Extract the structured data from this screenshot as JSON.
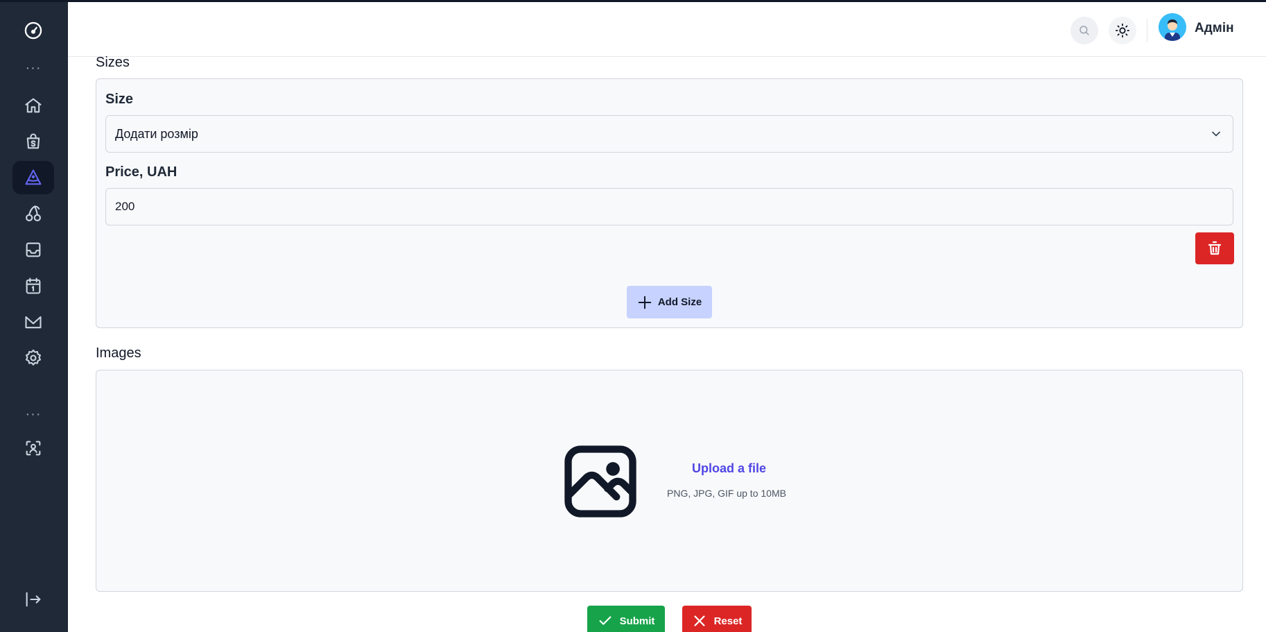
{
  "header": {
    "username": "Адмін",
    "search_icon": "search-icon",
    "theme_icon": "sun-icon",
    "avatar_icon": "avatar-icon"
  },
  "sidebar": {
    "logo_icon": "gauge-logo-icon",
    "items": [
      {
        "icon": "home-icon"
      },
      {
        "icon": "shopping-bag-icon"
      },
      {
        "icon": "pizza-slice-icon",
        "active": true
      },
      {
        "icon": "cherries-icon"
      },
      {
        "icon": "inbox-icon"
      },
      {
        "icon": "calendar-icon"
      },
      {
        "icon": "mail-icon"
      },
      {
        "icon": "settings-icon"
      },
      {
        "icon": "face-scan-icon"
      },
      {
        "icon": "logout-icon"
      }
    ]
  },
  "sizes": {
    "section_label": "Sizes",
    "size_label": "Size",
    "size_value": "Додати розмір",
    "price_label": "Price, UAH",
    "price_value": "200",
    "add_size_label": "Add Size"
  },
  "images": {
    "section_label": "Images",
    "upload_link": "Upload a file",
    "upload_hint": "PNG, JPG, GIF up to 10MB"
  },
  "actions": {
    "submit_label": "Submit",
    "reset_label": "Reset"
  },
  "colors": {
    "sidebar_bg": "#1f2937",
    "accent": "#4f46e5",
    "danger": "#dc2626",
    "success": "#16a34a",
    "add_size_bg": "#c7d2fe"
  }
}
